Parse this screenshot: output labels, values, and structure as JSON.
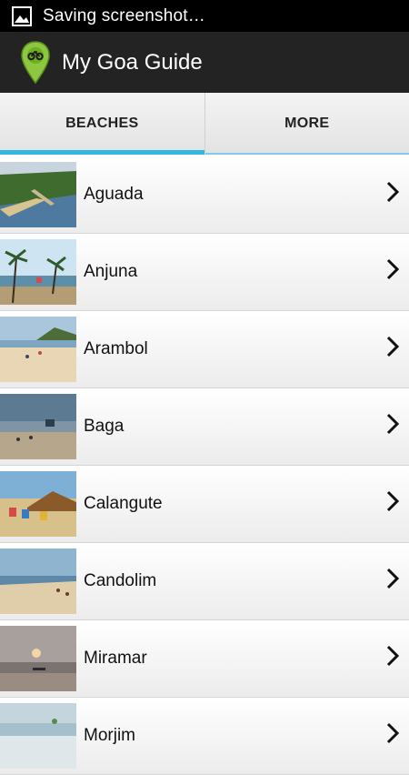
{
  "status_bar": {
    "notification_text": "Saving screenshot…",
    "icon": "image-icon"
  },
  "action_bar": {
    "title": "My Goa Guide",
    "icon": "location-pin-icon"
  },
  "tabs": [
    {
      "label": "BEACHES",
      "selected": true
    },
    {
      "label": "MORE",
      "selected": false
    }
  ],
  "beaches": [
    {
      "name": "Aguada"
    },
    {
      "name": "Anjuna"
    },
    {
      "name": "Arambol"
    },
    {
      "name": "Baga"
    },
    {
      "name": "Calangute"
    },
    {
      "name": "Candolim"
    },
    {
      "name": "Miramar"
    },
    {
      "name": "Morjim"
    }
  ],
  "colors": {
    "accent": "#33b5e5",
    "action_bar": "#232323",
    "status_bar": "#000000"
  }
}
